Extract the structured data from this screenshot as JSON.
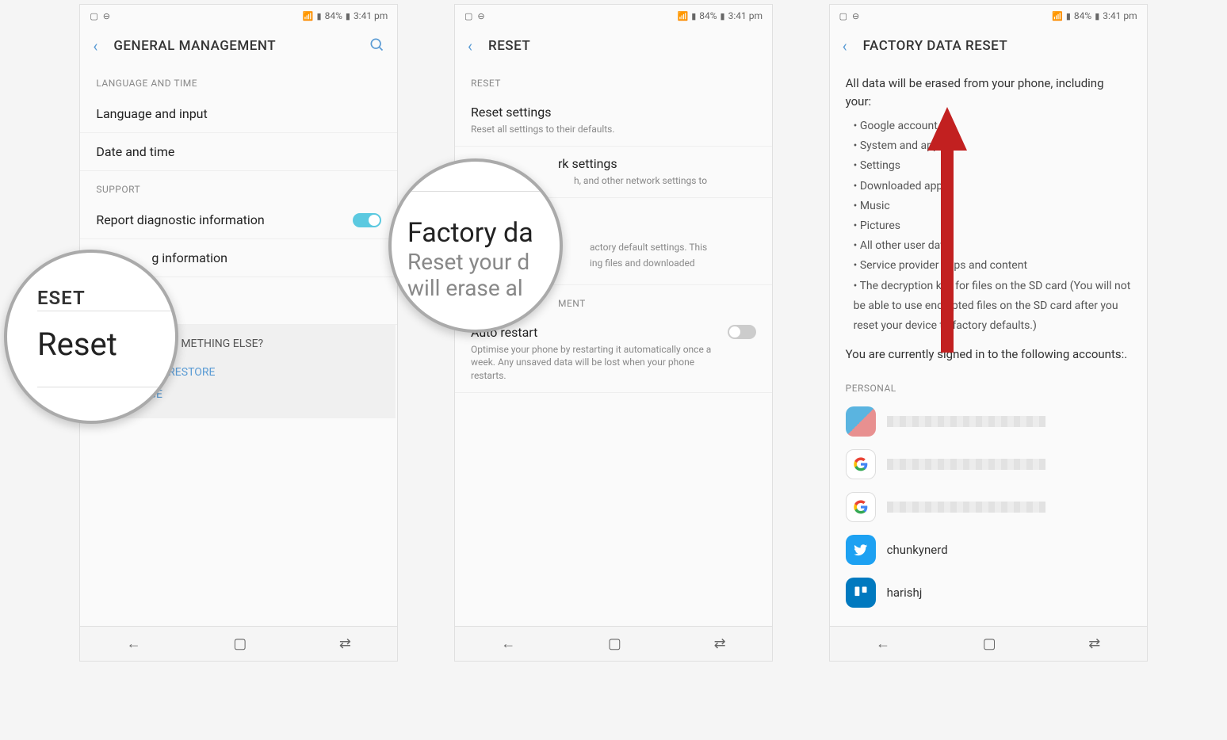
{
  "status_bar": {
    "battery": "84%",
    "time": "3:41 pm"
  },
  "screen1": {
    "title": "GENERAL MANAGEMENT",
    "section_lang": "LANGUAGE AND TIME",
    "lang_input": "Language and input",
    "date_time": "Date and time",
    "section_support": "SUPPORT",
    "report_diag": "Report diagnostic information",
    "marketing_info": "g information",
    "looking_title": "METHING ELSE?",
    "backup_restore": "BACKUP AND RESTORE",
    "data_usage": "DATA USAGE",
    "mag_small": "ESET",
    "mag_main": "Reset"
  },
  "screen2": {
    "title": "RESET",
    "section_reset": "RESET",
    "reset_settings": "Reset settings",
    "reset_settings_sub": "Reset all settings to their defaults.",
    "reset_network": "rk settings",
    "reset_network_sub": "h, and other network settings to",
    "factory_sub1": "actory default settings. This",
    "factory_sub2": "ing files and downloaded",
    "section_mgmt": "MENT",
    "auto_restart": "Auto restart",
    "auto_restart_sub": "Optimise your phone by restarting it automatically once a week. Any unsaved data will be lost when your phone restarts.",
    "mag_title": "Factory da",
    "mag_sub1": "Reset your d",
    "mag_sub2": "will erase al"
  },
  "screen3": {
    "title": "FACTORY DATA RESET",
    "intro": "All data will be erased from your phone, including your:",
    "bullets": [
      "Google account",
      "System and app data",
      "Settings",
      "Downloaded apps",
      "Music",
      "Pictures",
      "All other user data",
      "Service provider apps and content",
      "The decryption key for files on the SD card (You will not be able to use encrypted files on the SD card after you reset your device to factory defaults.)"
    ],
    "signed_in": "You are currently signed in to the following accounts:.",
    "section_personal": "PERSONAL",
    "account_twitter": "chunkynerd",
    "account_trello": "harishj"
  }
}
